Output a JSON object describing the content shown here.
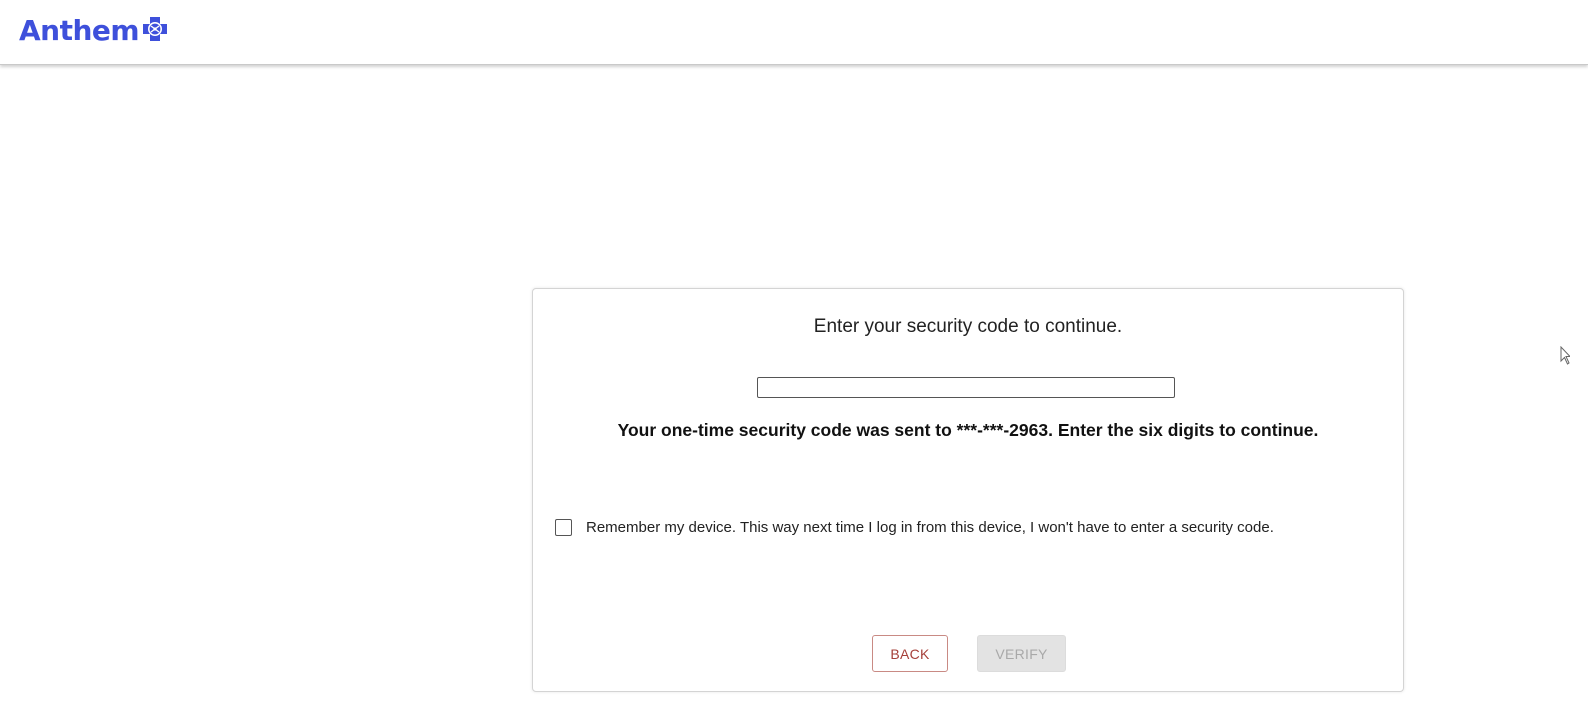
{
  "header": {
    "brand_name": "Anthem",
    "brand_icon": "anthem-cross-shield-icon",
    "brand_color": "#3e50db"
  },
  "card": {
    "title": "Enter your security code to continue.",
    "code_input": {
      "value": "",
      "placeholder": ""
    },
    "sent_message": "Your one-time security code was sent to ***-***-2963. Enter the six digits to continue.",
    "remember_device": {
      "checked": false,
      "label": "Remember my device. This way next time I log in from this device, I won't have to enter a security code."
    },
    "buttons": {
      "back_label": "BACK",
      "verify_label": "VERIFY"
    }
  },
  "colors": {
    "back_text": "#a6403a",
    "back_border": "#c98a84",
    "verify_text": "#a9a9a9",
    "verify_bg": "#e3e3e3"
  }
}
